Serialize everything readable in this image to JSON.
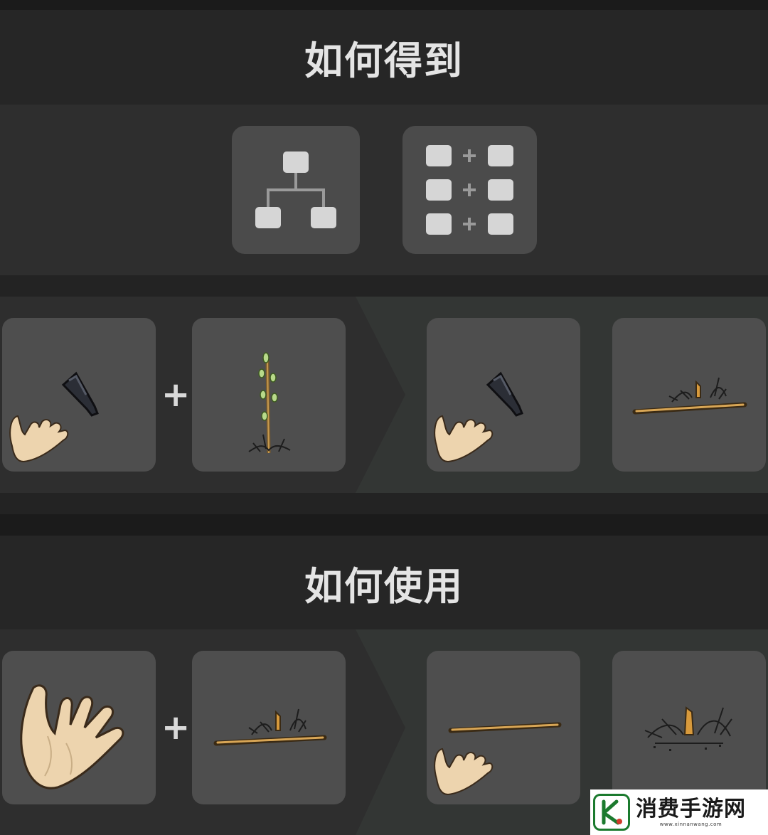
{
  "sections": {
    "obtain": {
      "title": "如何得到",
      "methods": [
        {
          "icon": "tree-diagram-icon",
          "selected": false
        },
        {
          "icon": "recipe-grid-icon",
          "selected": false
        }
      ],
      "recipe": {
        "inputs": [
          "hand-with-flint-icon",
          "sapling-icon"
        ],
        "plus": "+",
        "outputs": [
          "hand-with-flint-icon",
          "kindling-stick-icon"
        ]
      }
    },
    "use": {
      "title": "如何使用",
      "recipe": {
        "inputs": [
          "bare-hand-icon",
          "kindling-stick-icon"
        ],
        "plus": "+",
        "outputs": [
          "hand-with-stick-icon",
          "dry-tinder-icon"
        ]
      }
    }
  },
  "watermark": {
    "text": "消费手游网",
    "url": "www.xinnanwang.com"
  },
  "colors": {
    "background": "#1b1b1b",
    "title_band": "#262626",
    "content_band": "#2e2e2e",
    "output_band": "#333634",
    "slot": "#4e4e4e",
    "icon_fill": "#d6d6d6"
  }
}
